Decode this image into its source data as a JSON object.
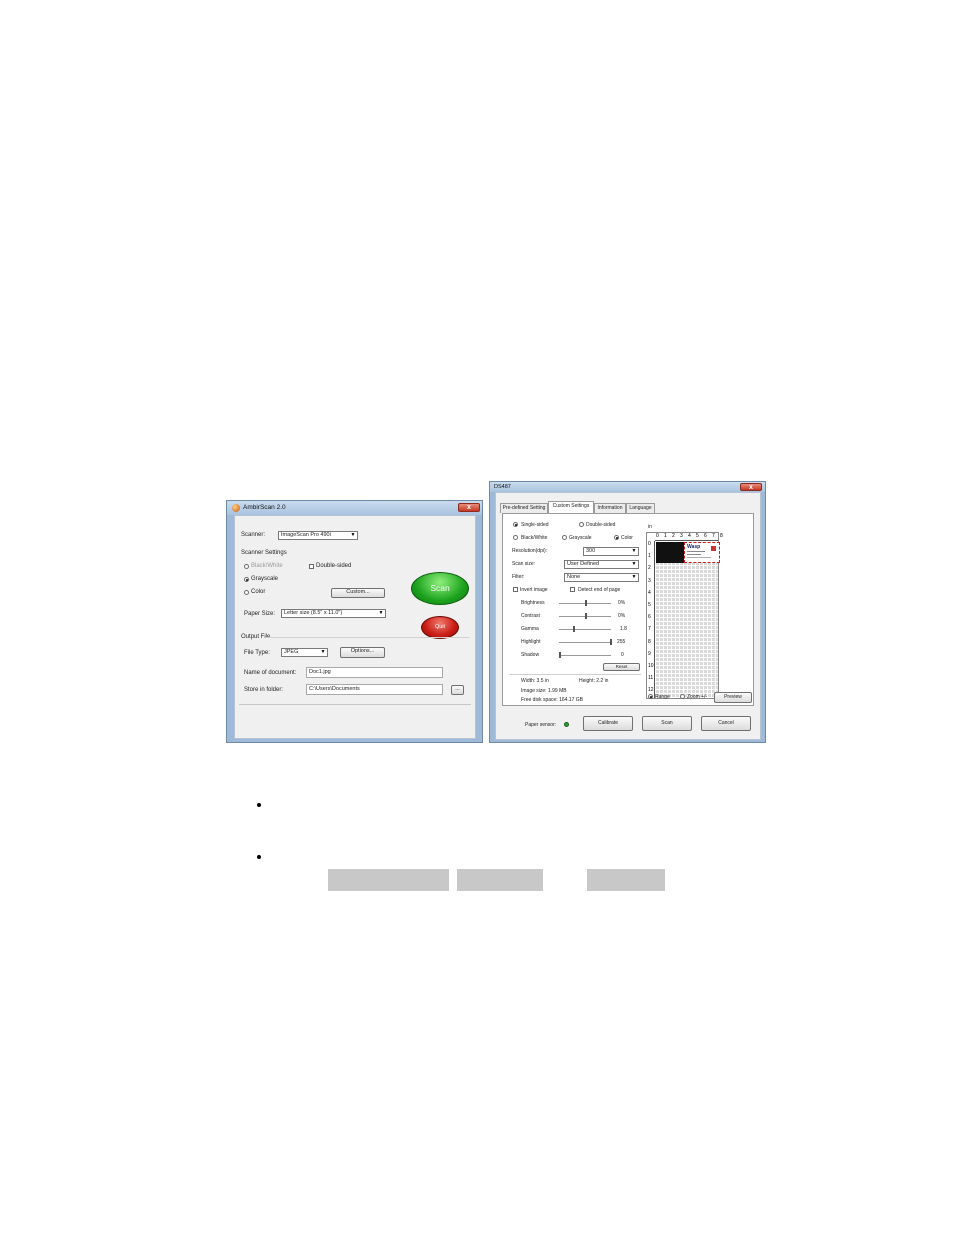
{
  "ambirscan": {
    "title": "AmbirScan 2.0",
    "close": "x",
    "scanner_label": "Scanner:",
    "scanner_value": "ImageScan Pro 490i",
    "scanner_settings_label": "Scanner Settings",
    "mode_bw": "Black/White",
    "mode_gray": "Grayscale",
    "mode_color": "Color",
    "double_sided": "Double-sided",
    "custom_button": "Custom...",
    "paper_size_label": "Paper Size:",
    "paper_size_value": "Letter size (8.5\" x 11.0\")",
    "scan_button": "Scan",
    "quit_button": "Quit",
    "output_file_label": "Output File",
    "file_type_label": "File Type:",
    "file_type_value": "JPEG",
    "options_button": "Options...",
    "doc_name_label": "Name of document:",
    "doc_name_value": "Doc1.jpg",
    "folder_label": "Store in folder:",
    "folder_value": "C:\\Users\\Documents",
    "browse_button": "..."
  },
  "ds487": {
    "title": "DS487",
    "close": "x",
    "tabs": [
      "Pre-defined Setting",
      "Custom Settings",
      "Information",
      "Language"
    ],
    "single_sided": "Single-sided",
    "double_sided": "Double-sided",
    "bw": "Black/White",
    "grayscale": "Grayscale",
    "color": "Color",
    "resolution_label": "Resolution(dpi):",
    "resolution_value": "300",
    "scan_size_label": "Scan size:",
    "scan_size_value": "User Defined",
    "filter_label": "Filter:",
    "filter_value": "None",
    "invert_image": "Invert image",
    "detect_end": "Detect end of page",
    "sliders": [
      {
        "label": "Brightness",
        "value": "0%"
      },
      {
        "label": "Contrast",
        "value": "0%"
      },
      {
        "label": "Gamma",
        "value": "1.8"
      },
      {
        "label": "Highlight",
        "value": "255"
      },
      {
        "label": "Shadow",
        "value": "0"
      }
    ],
    "reset_button": "Reset",
    "width_label": "Width: 3.5 in",
    "height_label": "Height: 2.2 in",
    "image_size": "Image size: 1.99 MB",
    "free_disk": "Free disk space: 164.17 GB",
    "ruler_unit": "in",
    "ruler_top": [
      "0",
      "1",
      "2",
      "3",
      "4",
      "5",
      "6",
      "7",
      "8"
    ],
    "ruler_left": [
      "0",
      "1",
      "2",
      "3",
      "4",
      "5",
      "6",
      "7",
      "8",
      "9",
      "10",
      "11",
      "12"
    ],
    "card_title": "Wasp",
    "range_label": "Range",
    "zoom_label": "Zoom +/-",
    "preview_button": "Preview",
    "paper_sensor_label": "Paper sensor:",
    "calibrate_button": "Calibrate",
    "scan_button": "Scan",
    "cancel_button": "Cancel"
  },
  "colors": {
    "scan_green": "#1da31f",
    "quit_red": "#c81b14",
    "sensor_green": "#2aa02a"
  }
}
